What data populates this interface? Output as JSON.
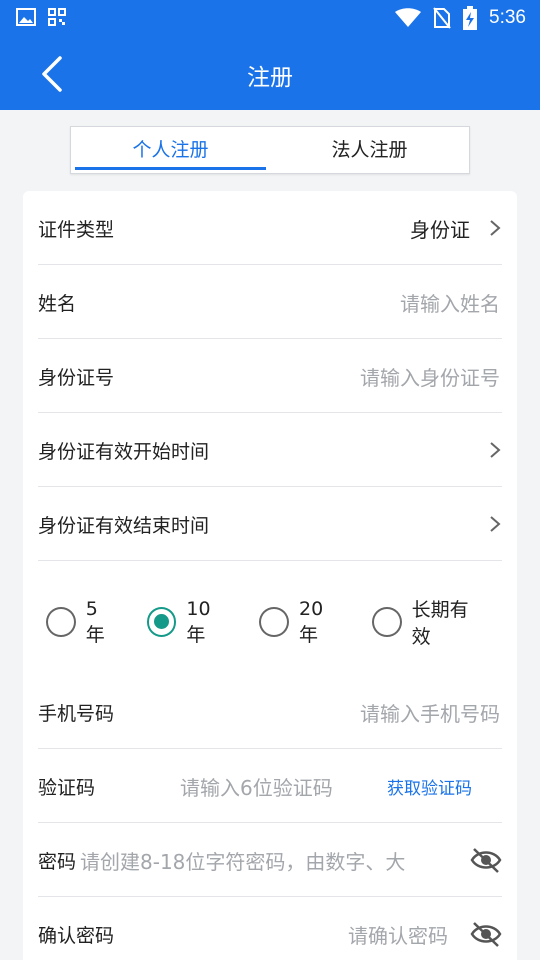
{
  "status_bar": {
    "time": "5:36",
    "icons": [
      "image-icon",
      "qr-app-icon",
      "wifi-icon",
      "no-sim-icon",
      "battery-charging-icon"
    ]
  },
  "app_bar": {
    "back_icon": "chevron-left-icon",
    "title": "注册"
  },
  "tabs": [
    {
      "label": "个人注册",
      "active": true
    },
    {
      "label": "法人注册",
      "active": false
    }
  ],
  "form": {
    "id_type": {
      "label": "证件类型",
      "value": "身份证"
    },
    "name": {
      "label": "姓名",
      "placeholder": "请输入姓名"
    },
    "id_number": {
      "label": "身份证号",
      "placeholder": "请输入身份证号"
    },
    "valid_start": {
      "label": "身份证有效开始时间"
    },
    "valid_end": {
      "label": "身份证有效结束时间"
    },
    "validity_options": [
      {
        "label": "5年",
        "checked": false
      },
      {
        "label": "10年",
        "checked": true
      },
      {
        "label": "20年",
        "checked": false
      },
      {
        "label": "长期有效",
        "checked": false
      }
    ],
    "phone": {
      "label": "手机号码",
      "placeholder": "请输入手机号码"
    },
    "code": {
      "label": "验证码",
      "placeholder": "请输入6位验证码",
      "button": "获取验证码"
    },
    "password": {
      "label": "密码",
      "placeholder": "请创建8-18位字符密码，由数字、大"
    },
    "confirm_password": {
      "label": "确认密码",
      "placeholder": "请确认密码"
    }
  },
  "colors": {
    "primary": "#1a73e8",
    "radio_checked": "#159a8a",
    "placeholder": "#a3a6ab"
  }
}
